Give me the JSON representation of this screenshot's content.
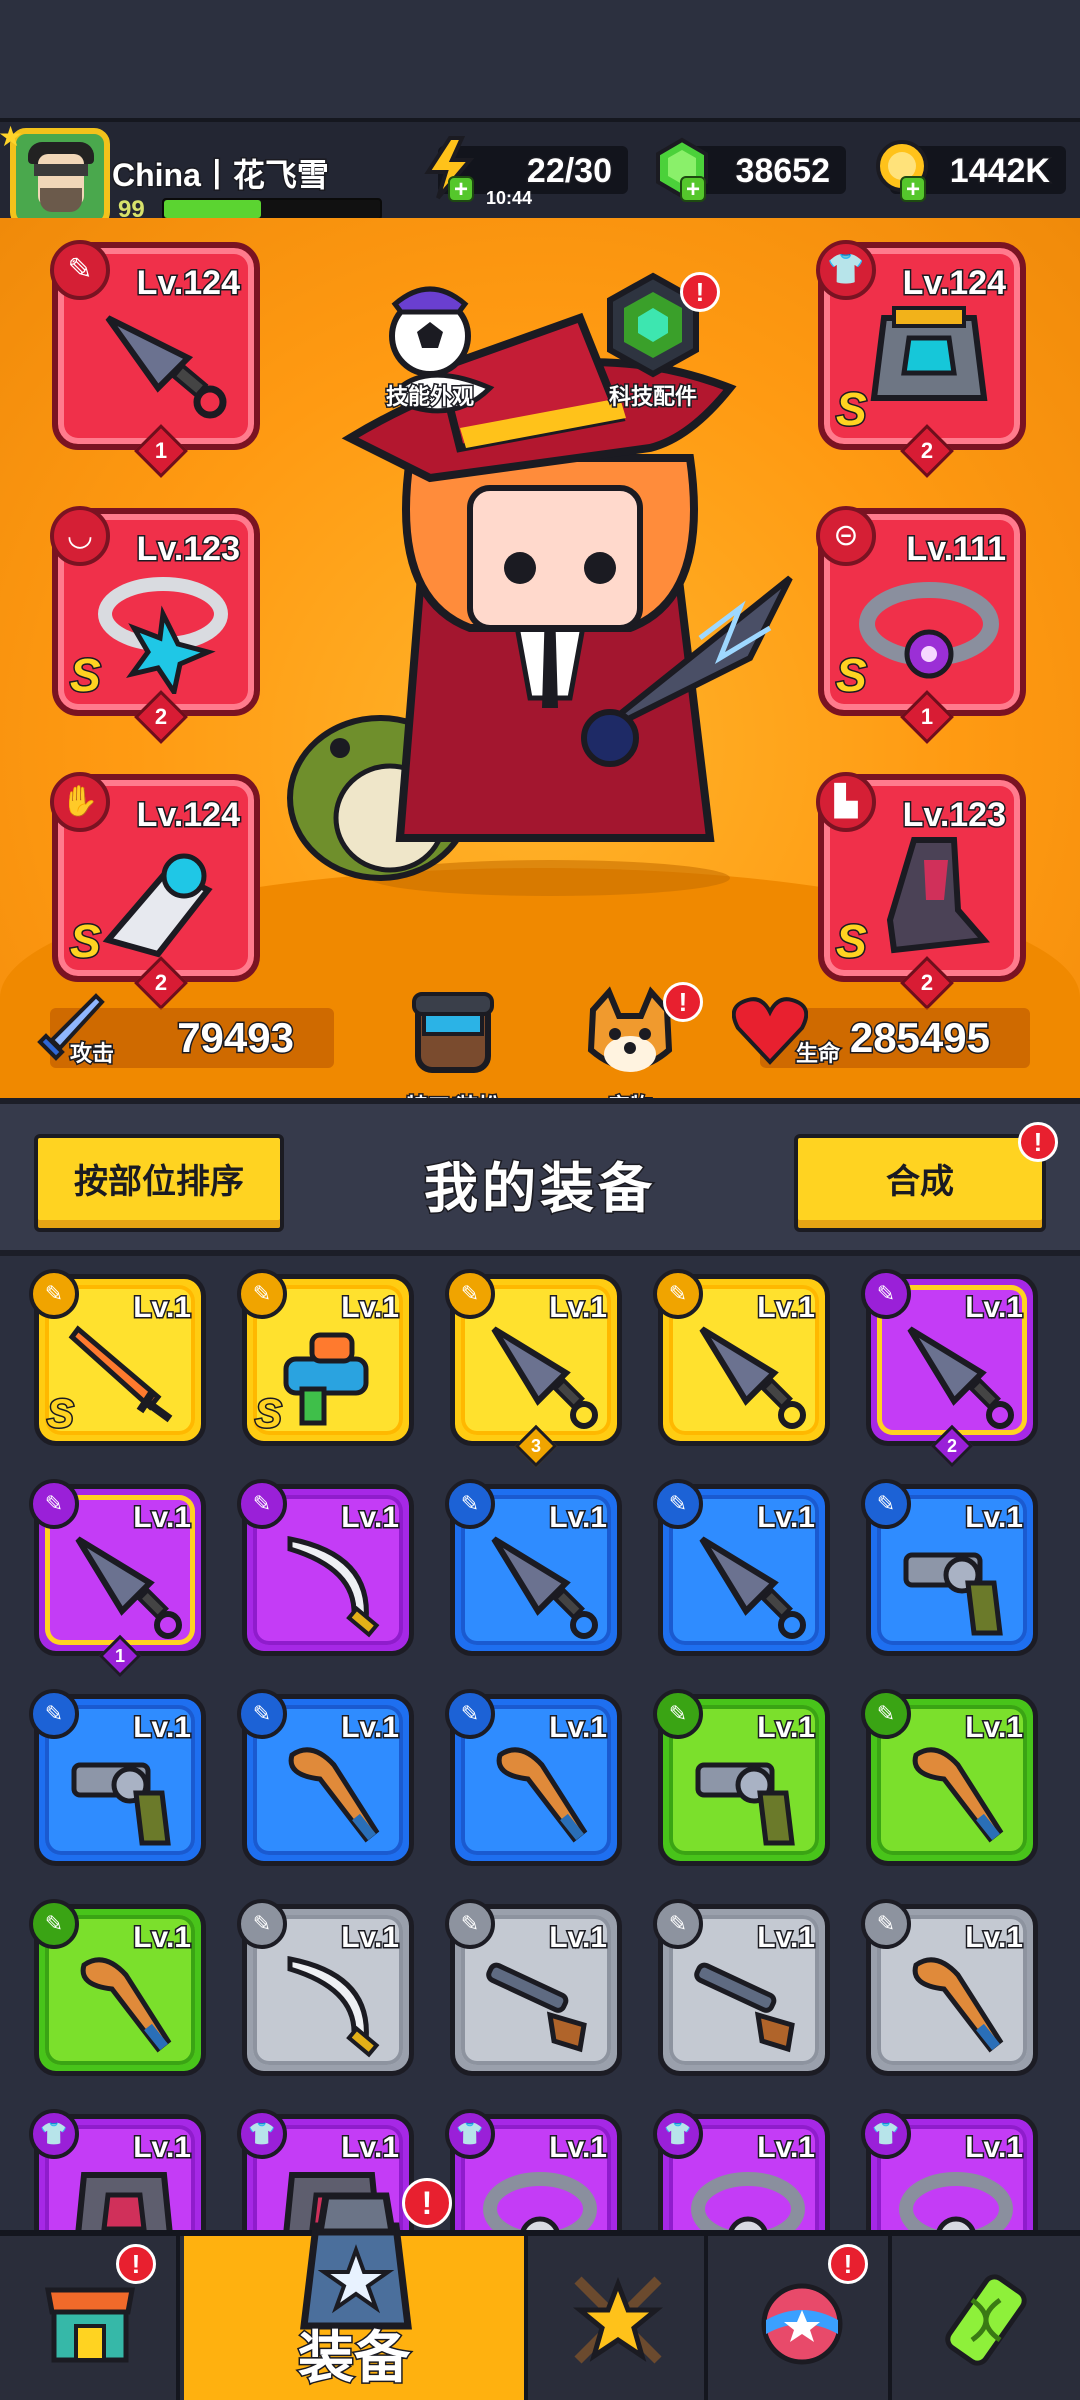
{
  "player": {
    "name": "China丨花飞雪",
    "level": "99",
    "xp_fraction": 0.45
  },
  "resources": {
    "energy": {
      "value": "22/30",
      "timer": "10:44",
      "color": "#ffc21a"
    },
    "gems": {
      "value": "38652",
      "color": "#4bd13a"
    },
    "gold": {
      "value": "1442K",
      "color": "#ffc21a"
    }
  },
  "equipped": [
    {
      "slot": "weapon",
      "level": "Lv.124",
      "stars": "1",
      "s_rank": "",
      "item": "kunai-icon"
    },
    {
      "slot": "armor",
      "level": "Lv.124",
      "stars": "2",
      "s_rank": "S",
      "item": "armor-icon"
    },
    {
      "slot": "necklace",
      "level": "Lv.123",
      "stars": "2",
      "s_rank": "S",
      "item": "necklace-icon"
    },
    {
      "slot": "belt",
      "level": "Lv.111",
      "stars": "1",
      "s_rank": "S",
      "item": "belt-icon"
    },
    {
      "slot": "gloves",
      "level": "Lv.124",
      "stars": "2",
      "s_rank": "S",
      "item": "gauntlet-icon"
    },
    {
      "slot": "boots",
      "level": "Lv.123",
      "stars": "2",
      "s_rank": "S",
      "item": "boots-icon"
    }
  ],
  "hero_buttons": {
    "skill_skin": "技能外观",
    "tech_parts": "科技配件",
    "agent_outfit": "特工/装扮",
    "pets": "宠物"
  },
  "stats": {
    "attack_label": "攻击",
    "attack_value": "79493",
    "hp_label": "生命",
    "hp_value": "285495"
  },
  "inventory_header": {
    "sort_label": "按部位排序",
    "title": "我的装备",
    "merge_label": "合成",
    "merge_alert": "!"
  },
  "inventory": [
    {
      "rarity": "gold",
      "level": "Lv.1",
      "s_rank": "S",
      "stars": "",
      "item": "sword-icon"
    },
    {
      "rarity": "gold",
      "level": "Lv.1",
      "s_rank": "S",
      "stars": "",
      "item": "water-gun-icon"
    },
    {
      "rarity": "gold",
      "level": "Lv.1",
      "s_rank": "",
      "stars": "3",
      "item": "kunai-icon"
    },
    {
      "rarity": "gold",
      "level": "Lv.1",
      "s_rank": "",
      "stars": "",
      "item": "kunai-icon"
    },
    {
      "rarity": "purple",
      "level": "Lv.1",
      "s_rank": "",
      "stars": "2",
      "item": "kunai-icon"
    },
    {
      "rarity": "purple",
      "level": "Lv.1",
      "s_rank": "",
      "stars": "1",
      "item": "kunai-icon"
    },
    {
      "rarity": "purple",
      "level": "Lv.1",
      "s_rank": "",
      "stars": "",
      "item": "scimitar-icon"
    },
    {
      "rarity": "blue",
      "level": "Lv.1",
      "s_rank": "",
      "stars": "",
      "item": "kunai-icon"
    },
    {
      "rarity": "blue",
      "level": "Lv.1",
      "s_rank": "",
      "stars": "",
      "item": "kunai-icon"
    },
    {
      "rarity": "blue",
      "level": "Lv.1",
      "s_rank": "",
      "stars": "",
      "item": "revolver-icon"
    },
    {
      "rarity": "blue",
      "level": "Lv.1",
      "s_rank": "",
      "stars": "",
      "item": "revolver-icon"
    },
    {
      "rarity": "blue",
      "level": "Lv.1",
      "s_rank": "",
      "stars": "",
      "item": "bat-icon"
    },
    {
      "rarity": "blue",
      "level": "Lv.1",
      "s_rank": "",
      "stars": "",
      "item": "bat-icon"
    },
    {
      "rarity": "green",
      "level": "Lv.1",
      "s_rank": "",
      "stars": "",
      "item": "revolver-icon"
    },
    {
      "rarity": "green",
      "level": "Lv.1",
      "s_rank": "",
      "stars": "",
      "item": "bat-icon"
    },
    {
      "rarity": "green",
      "level": "Lv.1",
      "s_rank": "",
      "stars": "",
      "item": "bat-icon"
    },
    {
      "rarity": "gray",
      "level": "Lv.1",
      "s_rank": "",
      "stars": "",
      "item": "scimitar-icon"
    },
    {
      "rarity": "gray",
      "level": "Lv.1",
      "s_rank": "",
      "stars": "",
      "item": "shotgun-icon"
    },
    {
      "rarity": "gray",
      "level": "Lv.1",
      "s_rank": "",
      "stars": "",
      "item": "shotgun-icon"
    },
    {
      "rarity": "gray",
      "level": "Lv.1",
      "s_rank": "",
      "stars": "",
      "item": "bat-icon"
    },
    {
      "rarity": "purple",
      "level": "Lv.1",
      "s_rank": "",
      "stars": "",
      "item": "armor-icon"
    },
    {
      "rarity": "purple",
      "level": "Lv.1",
      "s_rank": "",
      "stars": "",
      "item": "armor-icon"
    },
    {
      "rarity": "purple",
      "level": "Lv.1",
      "s_rank": "",
      "stars": "",
      "item": "belt-icon"
    },
    {
      "rarity": "purple",
      "level": "Lv.1",
      "s_rank": "",
      "stars": "",
      "item": "belt-icon"
    },
    {
      "rarity": "purple",
      "level": "Lv.1",
      "s_rank": "",
      "stars": "",
      "item": "belt-icon"
    }
  ],
  "bottom_nav": {
    "shop": {
      "icon": "shop-icon",
      "alert": "!"
    },
    "equipment": {
      "label": "装备",
      "icon": "equipment-bag-icon",
      "alert": "!"
    },
    "battle": {
      "icon": "battle-star-icon"
    },
    "eggs": {
      "icon": "egg-icon",
      "alert": "!"
    },
    "lab": {
      "icon": "dna-capsule-icon"
    }
  }
}
